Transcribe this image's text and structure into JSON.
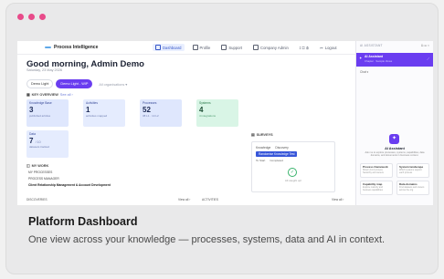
{
  "colors": {
    "accent": "#6a3df0",
    "dot": "#e84b8a",
    "primary_blue": "#3756d9"
  },
  "app": {
    "brand": "Process Intelligence",
    "nav": [
      "Dashboard",
      "Profile",
      "Support",
      "Company Admin",
      "Logout"
    ],
    "greeting": "Good morning, Admin Demo",
    "date": "Saturday, 23 May 2026",
    "pills": [
      "Demo Light",
      "Demo Light - WIP",
      "All organisations ▾"
    ],
    "key_overview": {
      "title": "KEY OVERVIEW",
      "sub": "See all ›"
    },
    "kpis": [
      {
        "label": "Knowledge Base",
        "value": "3",
        "note": "published articles",
        "bg": "#dfe7fd"
      },
      {
        "label": "Activities",
        "value": "1",
        "note": "activities mapped",
        "bg": "#e5ecfe"
      },
      {
        "label": "Processes",
        "value": "52",
        "note": "38 L1 · 14 L2",
        "bg": "#dfe7fd"
      },
      {
        "label": "Systems",
        "value": "4",
        "note": "4 integrations",
        "bg": "#d9f5e6"
      },
      {
        "label": "Data",
        "value": "7",
        "value_suffix": "/ 10",
        "note": "datasets tracked",
        "bg": "#e5ecfe"
      }
    ],
    "surveys": {
      "title": "SURVEYS",
      "tabs": [
        "Knowledge",
        "Discovery"
      ],
      "button": "Randomise Knowledge Test",
      "subtabs": [
        "To Start",
        "Completed"
      ],
      "empty": "All caught up!"
    },
    "my_work": {
      "title": "MY WORK",
      "items": [
        "MY PROCESSES",
        "PROCESS MANAGER",
        "Client Relationship Management & Account Development"
      ]
    },
    "bottom": {
      "overview": "DISCOVERIES",
      "view_all": "View all ›",
      "activities": "ACTIVITIES",
      "view_all_2": "View all ›"
    },
    "assistant": {
      "header": "AI ASSISTANT",
      "active_title": "AI Assistant",
      "active_sub": "Chapter · Sample Views",
      "list_item": "Chat ▾",
      "title": "AI Assistant",
      "desc": "Ask me to explore processes, systems, capabilities, data domains, and documents in business context.",
      "cards": [
        {
          "t": "Process framework",
          "d": "Show L0-L3 process hierarchy and owners"
        },
        {
          "t": "System landscape",
          "d": "Which systems support each process"
        },
        {
          "t": "Capability map",
          "d": "Explore maturity and business capabilities"
        },
        {
          "t": "Data domains",
          "d": "Find datasets and owners across the org"
        }
      ]
    }
  },
  "caption": {
    "title": "Platform Dashboard",
    "description": "One view across your knowledge — processes, systems, data and AI in context."
  }
}
